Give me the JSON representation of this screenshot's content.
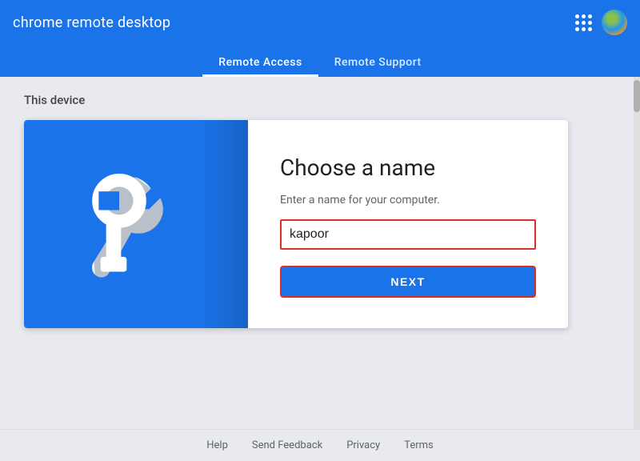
{
  "app": {
    "title": "chrome remote desktop"
  },
  "tabs": [
    {
      "id": "remote-access",
      "label": "Remote Access",
      "active": true
    },
    {
      "id": "remote-support",
      "label": "Remote Support",
      "active": false
    }
  ],
  "section": {
    "device_label": "This device"
  },
  "dialog": {
    "title": "Choose a name",
    "subtitle": "Enter a name for your computer.",
    "input_value": "kapoor",
    "input_placeholder": "kapoor",
    "next_button_label": "NEXT"
  },
  "footer": {
    "links": [
      {
        "id": "help",
        "label": "Help"
      },
      {
        "id": "send-feedback",
        "label": "Send Feedback"
      },
      {
        "id": "privacy",
        "label": "Privacy"
      },
      {
        "id": "terms",
        "label": "Terms"
      }
    ]
  }
}
